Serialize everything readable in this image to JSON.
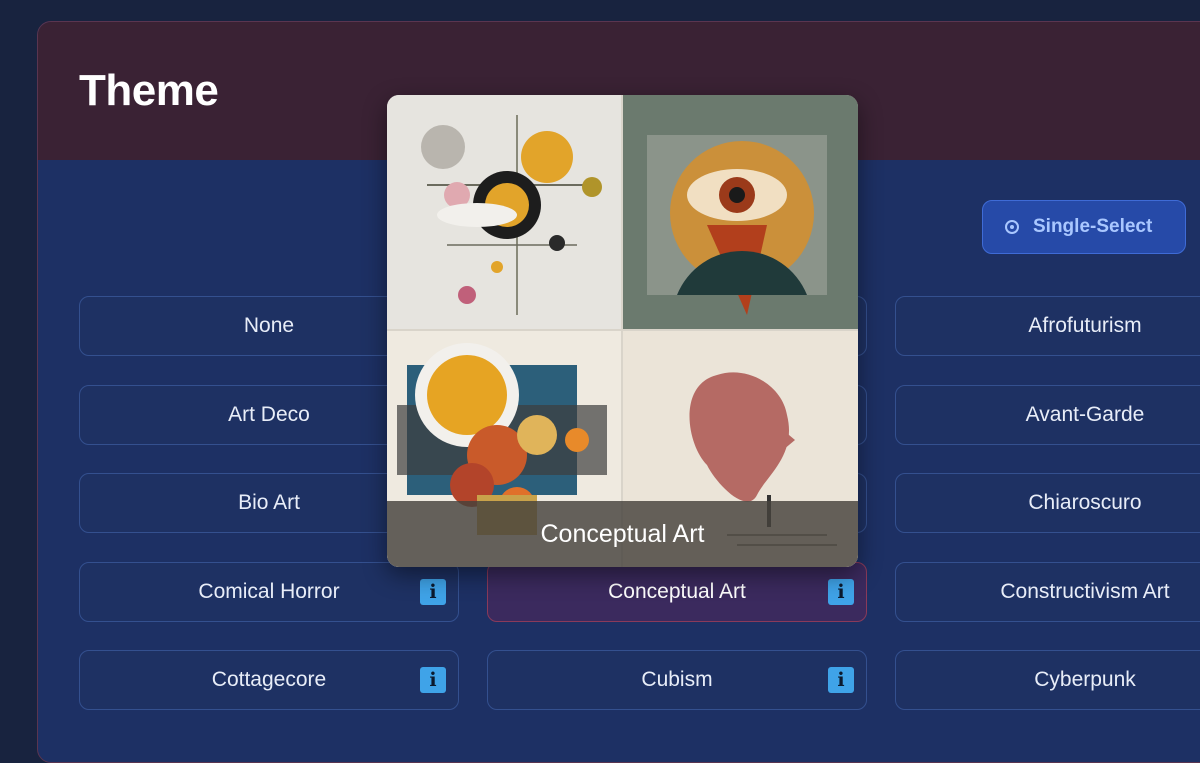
{
  "theme": {
    "title": "Theme",
    "select_mode": {
      "label": "Single-Select",
      "icon": "radio-icon"
    },
    "options": [
      {
        "label": "None",
        "info": false
      },
      {
        "label": "Afrofuturism",
        "info": false
      },
      {
        "label": "Art Deco",
        "info": false
      },
      {
        "label": "Avant-Garde",
        "info": false
      },
      {
        "label": "Bio Art",
        "info": false
      },
      {
        "label": "Chiaroscuro",
        "info": false
      },
      {
        "label": "Comical Horror",
        "info": true
      },
      {
        "label": "Conceptual Art",
        "info": true,
        "selected": true
      },
      {
        "label": "Constructivism Art",
        "info": false
      },
      {
        "label": "Cottagecore",
        "info": true
      },
      {
        "label": "Cubism",
        "info": true
      },
      {
        "label": "Cyberpunk",
        "info": false
      }
    ],
    "info_icon_glyph": "i",
    "preview": {
      "caption": "Conceptual Art"
    }
  },
  "colors": {
    "background": "#18233f",
    "panel": "#1d3064",
    "header": "#3a2234",
    "accent": "#264aa8",
    "selected": "#3b2a5e",
    "info": "#3fa3e8"
  }
}
